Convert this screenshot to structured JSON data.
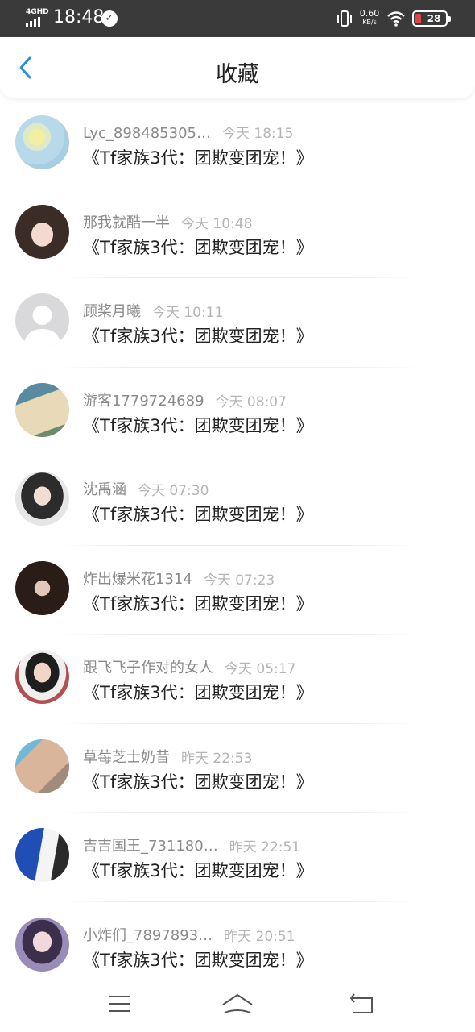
{
  "status_bar": {
    "network": "4GHD",
    "time": "18:48",
    "speed_value": "0.60",
    "speed_unit": "KB/s",
    "battery": "28"
  },
  "header": {
    "title": "收藏"
  },
  "items": [
    {
      "username": "Lyc_898485305…",
      "time": "今天 18:15",
      "book": "《Tf家族3代：团欺变团宠！》"
    },
    {
      "username": "那我就酷一半",
      "time": "今天 10:48",
      "book": "《Tf家族3代：团欺变团宠！》"
    },
    {
      "username": "顾桨月曦",
      "time": "今天 10:11",
      "book": "《Tf家族3代：团欺变团宠！》"
    },
    {
      "username": "游客1779724689",
      "time": "今天 08:07",
      "book": "《Tf家族3代：团欺变团宠！》"
    },
    {
      "username": "沈禹涵",
      "time": "今天 07:30",
      "book": "《Tf家族3代：团欺变团宠！》"
    },
    {
      "username": "炸出爆米花1314",
      "time": "今天 07:23",
      "book": "《Tf家族3代：团欺变团宠！》"
    },
    {
      "username": "跟飞飞子作对的女人",
      "time": "今天 05:17",
      "book": "《Tf家族3代：团欺变团宠！》"
    },
    {
      "username": "草莓芝士奶昔",
      "time": "昨天 22:53",
      "book": "《Tf家族3代：团欺变团宠！》"
    },
    {
      "username": "吉吉国王_731180…",
      "time": "昨天 22:51",
      "book": "《Tf家族3代：团欺变团宠！》"
    },
    {
      "username": "小炸们_7897893…",
      "time": "昨天 20:51",
      "book": "《Tf家族3代：团欺变团宠！》"
    }
  ],
  "icons": {
    "back": "chevron-left-icon",
    "menu": "menu-icon",
    "home": "home-icon",
    "return": "return-icon"
  },
  "colors": {
    "accent": "#2a8ee0",
    "status_bar": "#3a3a3a",
    "battery_low": "#e04646"
  }
}
